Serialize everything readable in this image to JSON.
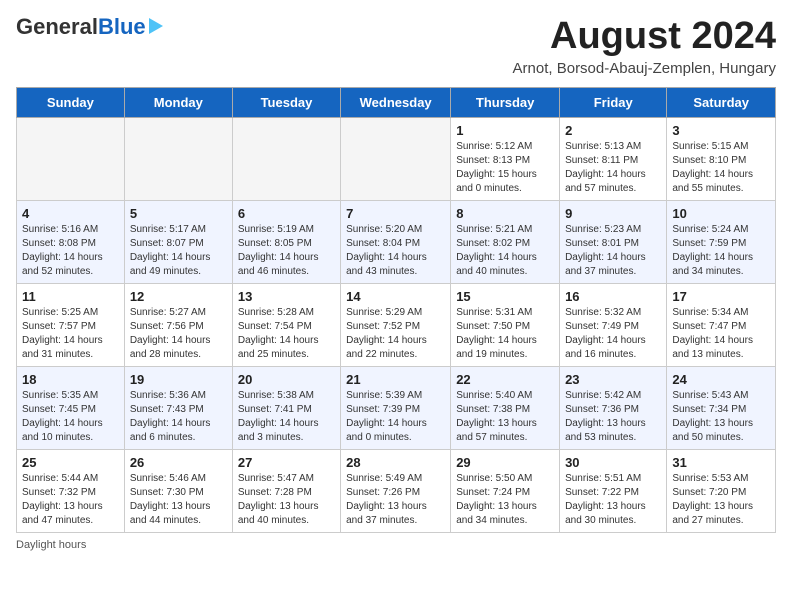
{
  "header": {
    "logo_general": "General",
    "logo_blue": "Blue",
    "month_year": "August 2024",
    "location": "Arnot, Borsod-Abauj-Zemplen, Hungary"
  },
  "days_of_week": [
    "Sunday",
    "Monday",
    "Tuesday",
    "Wednesday",
    "Thursday",
    "Friday",
    "Saturday"
  ],
  "weeks": [
    [
      {
        "day": "",
        "info": ""
      },
      {
        "day": "",
        "info": ""
      },
      {
        "day": "",
        "info": ""
      },
      {
        "day": "",
        "info": ""
      },
      {
        "day": "1",
        "info": "Sunrise: 5:12 AM\nSunset: 8:13 PM\nDaylight: 15 hours and 0 minutes."
      },
      {
        "day": "2",
        "info": "Sunrise: 5:13 AM\nSunset: 8:11 PM\nDaylight: 14 hours and 57 minutes."
      },
      {
        "day": "3",
        "info": "Sunrise: 5:15 AM\nSunset: 8:10 PM\nDaylight: 14 hours and 55 minutes."
      }
    ],
    [
      {
        "day": "4",
        "info": "Sunrise: 5:16 AM\nSunset: 8:08 PM\nDaylight: 14 hours and 52 minutes."
      },
      {
        "day": "5",
        "info": "Sunrise: 5:17 AM\nSunset: 8:07 PM\nDaylight: 14 hours and 49 minutes."
      },
      {
        "day": "6",
        "info": "Sunrise: 5:19 AM\nSunset: 8:05 PM\nDaylight: 14 hours and 46 minutes."
      },
      {
        "day": "7",
        "info": "Sunrise: 5:20 AM\nSunset: 8:04 PM\nDaylight: 14 hours and 43 minutes."
      },
      {
        "day": "8",
        "info": "Sunrise: 5:21 AM\nSunset: 8:02 PM\nDaylight: 14 hours and 40 minutes."
      },
      {
        "day": "9",
        "info": "Sunrise: 5:23 AM\nSunset: 8:01 PM\nDaylight: 14 hours and 37 minutes."
      },
      {
        "day": "10",
        "info": "Sunrise: 5:24 AM\nSunset: 7:59 PM\nDaylight: 14 hours and 34 minutes."
      }
    ],
    [
      {
        "day": "11",
        "info": "Sunrise: 5:25 AM\nSunset: 7:57 PM\nDaylight: 14 hours and 31 minutes."
      },
      {
        "day": "12",
        "info": "Sunrise: 5:27 AM\nSunset: 7:56 PM\nDaylight: 14 hours and 28 minutes."
      },
      {
        "day": "13",
        "info": "Sunrise: 5:28 AM\nSunset: 7:54 PM\nDaylight: 14 hours and 25 minutes."
      },
      {
        "day": "14",
        "info": "Sunrise: 5:29 AM\nSunset: 7:52 PM\nDaylight: 14 hours and 22 minutes."
      },
      {
        "day": "15",
        "info": "Sunrise: 5:31 AM\nSunset: 7:50 PM\nDaylight: 14 hours and 19 minutes."
      },
      {
        "day": "16",
        "info": "Sunrise: 5:32 AM\nSunset: 7:49 PM\nDaylight: 14 hours and 16 minutes."
      },
      {
        "day": "17",
        "info": "Sunrise: 5:34 AM\nSunset: 7:47 PM\nDaylight: 14 hours and 13 minutes."
      }
    ],
    [
      {
        "day": "18",
        "info": "Sunrise: 5:35 AM\nSunset: 7:45 PM\nDaylight: 14 hours and 10 minutes."
      },
      {
        "day": "19",
        "info": "Sunrise: 5:36 AM\nSunset: 7:43 PM\nDaylight: 14 hours and 6 minutes."
      },
      {
        "day": "20",
        "info": "Sunrise: 5:38 AM\nSunset: 7:41 PM\nDaylight: 14 hours and 3 minutes."
      },
      {
        "day": "21",
        "info": "Sunrise: 5:39 AM\nSunset: 7:39 PM\nDaylight: 14 hours and 0 minutes."
      },
      {
        "day": "22",
        "info": "Sunrise: 5:40 AM\nSunset: 7:38 PM\nDaylight: 13 hours and 57 minutes."
      },
      {
        "day": "23",
        "info": "Sunrise: 5:42 AM\nSunset: 7:36 PM\nDaylight: 13 hours and 53 minutes."
      },
      {
        "day": "24",
        "info": "Sunrise: 5:43 AM\nSunset: 7:34 PM\nDaylight: 13 hours and 50 minutes."
      }
    ],
    [
      {
        "day": "25",
        "info": "Sunrise: 5:44 AM\nSunset: 7:32 PM\nDaylight: 13 hours and 47 minutes."
      },
      {
        "day": "26",
        "info": "Sunrise: 5:46 AM\nSunset: 7:30 PM\nDaylight: 13 hours and 44 minutes."
      },
      {
        "day": "27",
        "info": "Sunrise: 5:47 AM\nSunset: 7:28 PM\nDaylight: 13 hours and 40 minutes."
      },
      {
        "day": "28",
        "info": "Sunrise: 5:49 AM\nSunset: 7:26 PM\nDaylight: 13 hours and 37 minutes."
      },
      {
        "day": "29",
        "info": "Sunrise: 5:50 AM\nSunset: 7:24 PM\nDaylight: 13 hours and 34 minutes."
      },
      {
        "day": "30",
        "info": "Sunrise: 5:51 AM\nSunset: 7:22 PM\nDaylight: 13 hours and 30 minutes."
      },
      {
        "day": "31",
        "info": "Sunrise: 5:53 AM\nSunset: 7:20 PM\nDaylight: 13 hours and 27 minutes."
      }
    ]
  ],
  "footer": {
    "daylight_label": "Daylight hours"
  }
}
